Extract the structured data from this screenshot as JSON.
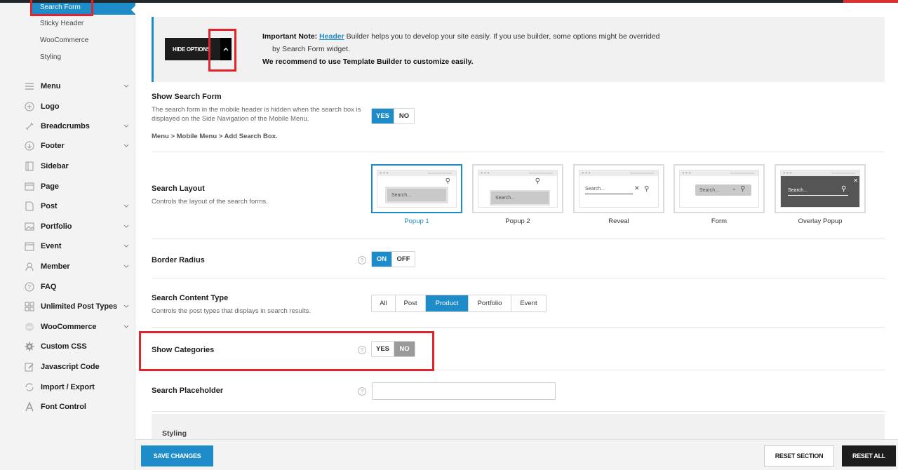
{
  "sidebar": {
    "sub_items": [
      "Search Form",
      "Sticky Header",
      "WooCommerce",
      "Styling"
    ],
    "items": [
      {
        "label": "Menu",
        "icon": "menu-icon"
      },
      {
        "label": "Logo",
        "icon": "plus-circle-icon"
      },
      {
        "label": "Breadcrumbs",
        "icon": "link-icon"
      },
      {
        "label": "Footer",
        "icon": "arrow-down-circle-icon"
      },
      {
        "label": "Sidebar",
        "icon": "sidebar-icon"
      },
      {
        "label": "Page",
        "icon": "page-icon"
      },
      {
        "label": "Post",
        "icon": "post-icon"
      },
      {
        "label": "Portfolio",
        "icon": "image-icon"
      },
      {
        "label": "Event",
        "icon": "calendar-icon"
      },
      {
        "label": "Member",
        "icon": "member-icon"
      },
      {
        "label": "FAQ",
        "icon": "question-circle-icon"
      },
      {
        "label": "Unlimited Post Types",
        "icon": "grid-icon"
      },
      {
        "label": "WooCommerce",
        "icon": "woocommerce-icon"
      },
      {
        "label": "Custom CSS",
        "icon": "gear-icon"
      },
      {
        "label": "Javascript Code",
        "icon": "edit-icon"
      },
      {
        "label": "Import / Export",
        "icon": "sync-icon"
      },
      {
        "label": "Font Control",
        "icon": "font-icon"
      }
    ]
  },
  "note": {
    "hide_options": "HIDE OPTIONS",
    "heading": "Important Note:",
    "link": "Header",
    "text1": " Builder helps you to develop your site easily. If you use builder, some options might be overrided",
    "text2": "by Search Form widget.",
    "recommend": "We recommend to use Template Builder to customize easily."
  },
  "show_search_form": {
    "title": "Show Search Form",
    "desc": "The search form in the mobile header is hidden when the search box is displayed on the Side Navigation of the Mobile Menu.",
    "path": "Menu > Mobile Menu > Add Search Box.",
    "yes": "YES",
    "no": "NO"
  },
  "search_layout": {
    "title": "Search Layout",
    "desc": "Controls the layout of the search forms.",
    "options": [
      "Popup 1",
      "Popup 2",
      "Reveal",
      "Form",
      "Overlay Popup"
    ],
    "placeholder_text": "Search..."
  },
  "border_radius": {
    "title": "Border Radius",
    "on": "ON",
    "off": "OFF"
  },
  "content_type": {
    "title": "Search Content Type",
    "desc": "Controls the post types that displays in search results.",
    "options": [
      "All",
      "Post",
      "Product",
      "Portfolio",
      "Event"
    ]
  },
  "show_categories": {
    "title": "Show Categories",
    "yes": "YES",
    "no": "NO"
  },
  "search_placeholder": {
    "title": "Search Placeholder",
    "value": ""
  },
  "styling_panel": {
    "label": "Styling"
  },
  "footer": {
    "save": "SAVE CHANGES",
    "reset_section": "RESET SECTION",
    "reset_all": "RESET ALL"
  },
  "colors": {
    "accent": "#1e8cc9",
    "highlight": "#e0242b",
    "dark": "#1d1d1d"
  }
}
